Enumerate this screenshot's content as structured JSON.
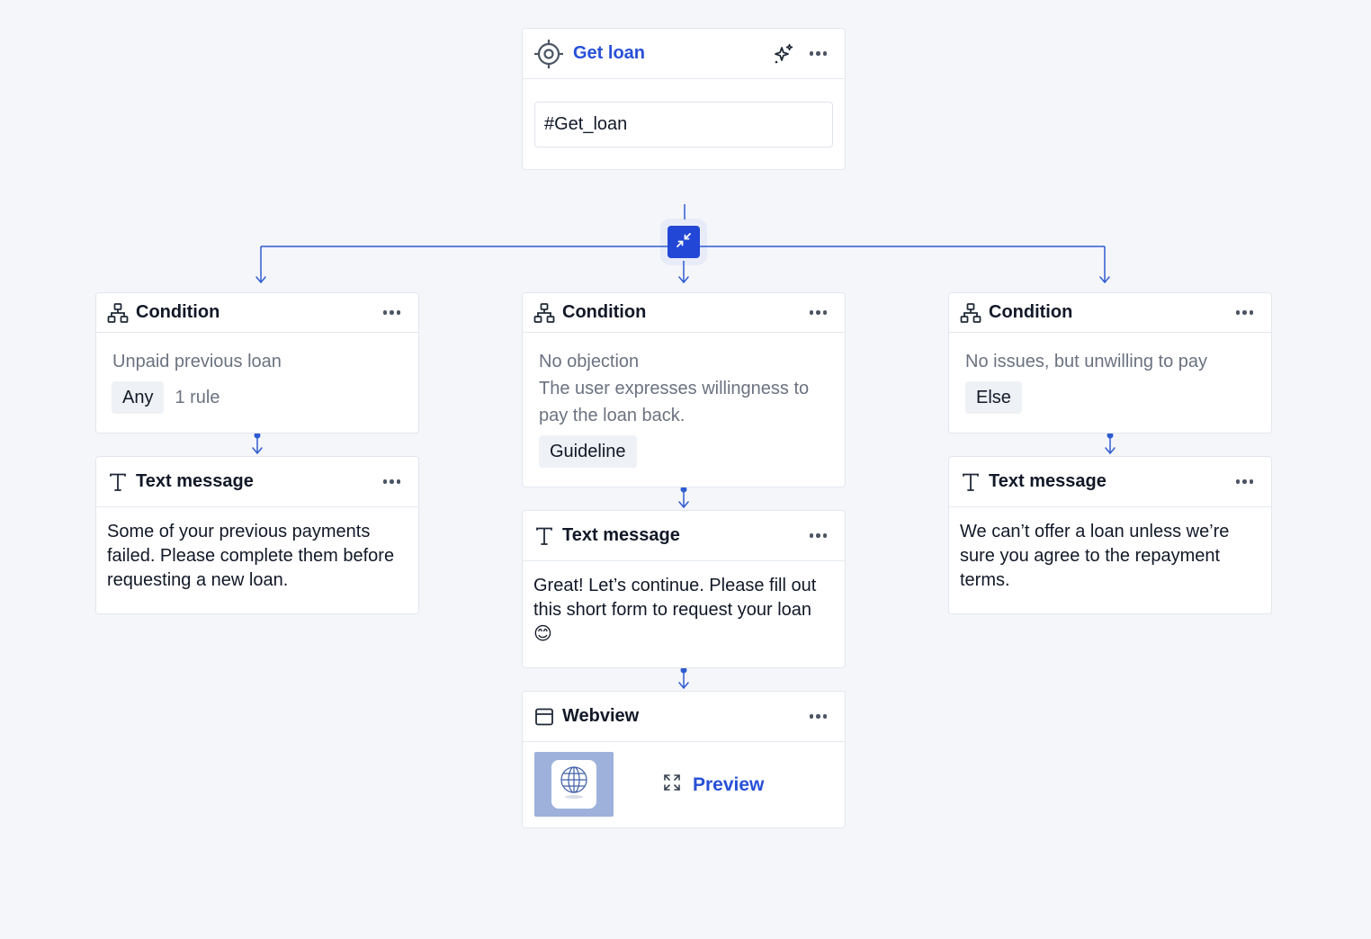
{
  "trigger": {
    "title": "Get loan",
    "input_value": "#Get_loan"
  },
  "columns": [
    {
      "condition": {
        "title": "Condition",
        "name": "Unpaid previous loan",
        "chip": "Any",
        "rule": "1 rule"
      },
      "message": {
        "title": "Text message",
        "text": "Some of your previous payments failed. Please complete them before requesting a new loan."
      }
    },
    {
      "condition": {
        "title": "Condition",
        "name": "No objection",
        "description": "The user expresses willingness to pay the loan back.",
        "chip": "Guideline"
      },
      "message": {
        "title": "Text message",
        "text": "Great! Let’s continue. Please fill out this short form to request your loan 😊"
      },
      "webview": {
        "title": "Webview",
        "preview_label": "Preview"
      }
    },
    {
      "condition": {
        "title": "Condition",
        "name": "No issues, but unwilling to pay",
        "chip": "Else"
      },
      "message": {
        "title": "Text message",
        "text": "We can’t offer a loan unless we’re sure you agree to the repayment terms."
      }
    }
  ],
  "colors": {
    "accent": "#2750d8",
    "connector": "#2e5bd0",
    "collapse_button": "#2247d6",
    "thumbnail_bg": "#9db1da"
  },
  "icons": {
    "trigger": "target-icon",
    "ai": "sparkle-icon",
    "more": "more-dots-icon",
    "condition": "sitemap-icon",
    "text": "text-t-icon",
    "webview": "browser-window-icon",
    "collapse": "collapse-arrows-icon",
    "expand": "expand-arrows-icon",
    "globe": "globe-icon"
  }
}
